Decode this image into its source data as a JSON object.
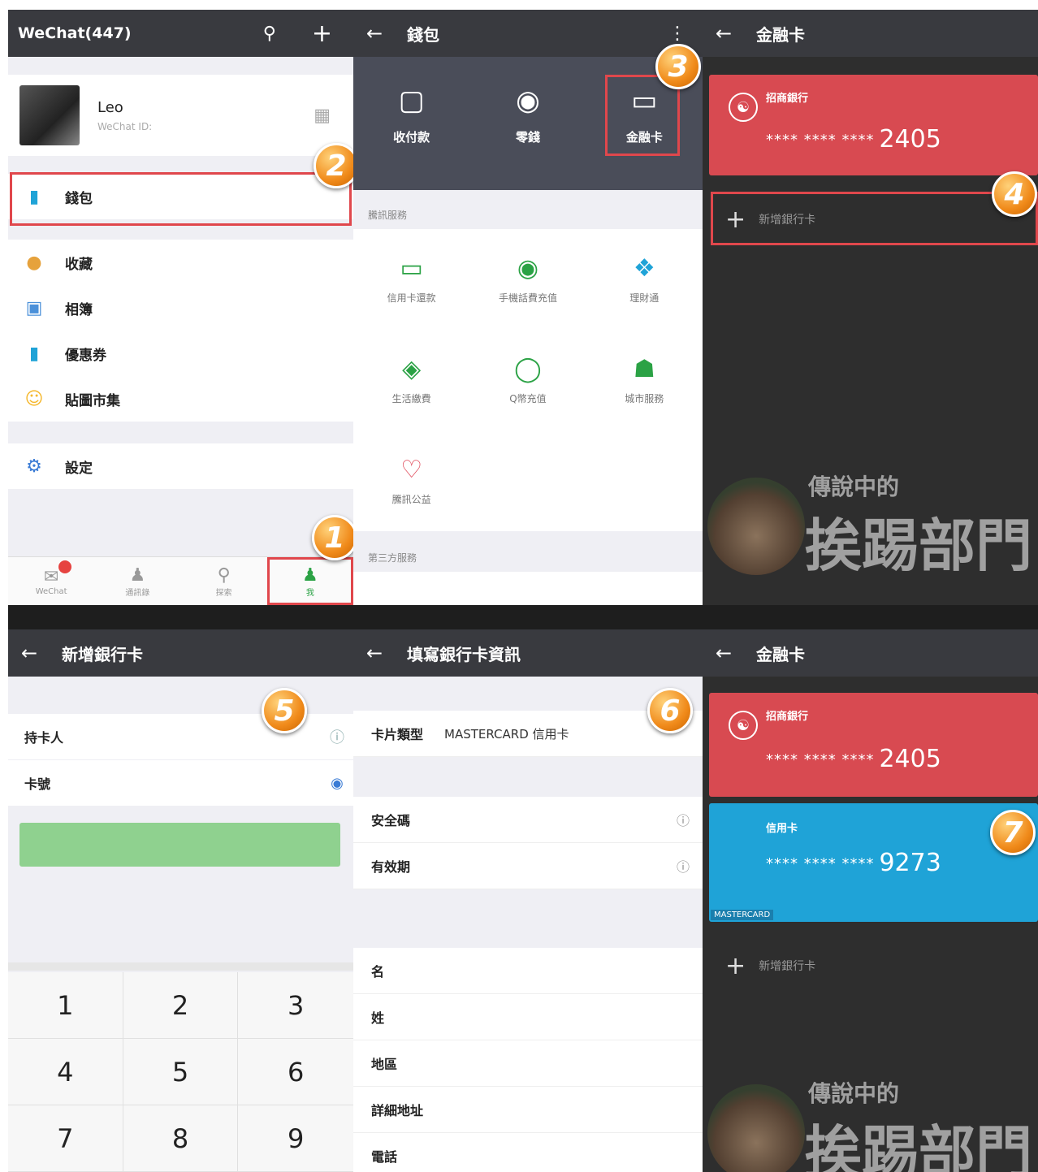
{
  "panel1": {
    "app_title": "WeChat(447)",
    "profile": {
      "name": "Leo",
      "wechat_id": "WeChat ID:"
    },
    "menu": [
      {
        "label": "錢包",
        "icon": "wallet-icon"
      },
      {
        "label": "收藏",
        "icon": "favorites-icon"
      },
      {
        "label": "相簿",
        "icon": "album-icon"
      },
      {
        "label": "優惠券",
        "icon": "coupon-icon"
      },
      {
        "label": "貼圖市集",
        "icon": "sticker-icon"
      },
      {
        "label": "設定",
        "icon": "settings-icon"
      }
    ],
    "tabs": [
      {
        "label": "WeChat",
        "icon": "chat-icon"
      },
      {
        "label": "通訊錄",
        "icon": "contacts-icon"
      },
      {
        "label": "探索",
        "icon": "discover-icon"
      },
      {
        "label": "我",
        "icon": "me-icon"
      }
    ]
  },
  "panel2": {
    "title": "錢包",
    "top_items": [
      {
        "label": "收付款",
        "sub": "",
        "icon": "scan-icon"
      },
      {
        "label": "零錢",
        "sub": "",
        "icon": "coin-icon"
      },
      {
        "label": "金融卡",
        "sub": "",
        "icon": "card-icon"
      }
    ],
    "section_title": "騰訊服務",
    "services": [
      {
        "label": "信用卡還款",
        "icon": "credit-card-icon"
      },
      {
        "label": "手機話費充值",
        "icon": "phone-topup-icon"
      },
      {
        "label": "理財通",
        "icon": "finance-icon"
      },
      {
        "label": "生活繳費",
        "icon": "bills-icon"
      },
      {
        "label": "Q幣充值",
        "icon": "qcoin-icon"
      },
      {
        "label": "城市服務",
        "icon": "city-icon"
      },
      {
        "label": "騰訊公益",
        "icon": "charity-icon"
      }
    ],
    "section_title_2": "第三方服務"
  },
  "panel3": {
    "title": "金融卡",
    "card": {
      "bank": "招商銀行",
      "type": "",
      "masked": "**** **** ****",
      "last4": "2405"
    },
    "add_label": "新增銀行卡"
  },
  "panel4": {
    "status_left": "",
    "status_right": "",
    "title": "新增銀行卡",
    "section_note": "",
    "holder_label": "持卡人",
    "holder_value": "",
    "cardno_label": "卡號",
    "cardno_placeholder": "",
    "keys": [
      "1",
      "2",
      "3",
      "4",
      "5",
      "6",
      "7",
      "8",
      "9"
    ]
  },
  "panel5": {
    "title": "填寫銀行卡資訊",
    "section1": "",
    "card_type_label": "卡片類型",
    "card_type_value": "MASTERCARD 信用卡",
    "section2": "",
    "cvv_label": "安全碼",
    "cvv_placeholder": "",
    "expiry_label": "有效期",
    "expiry_placeholder": "",
    "section3": "",
    "fields": [
      {
        "label": "名",
        "placeholder": ""
      },
      {
        "label": "姓",
        "placeholder": ""
      },
      {
        "label": "地區",
        "placeholder": ""
      },
      {
        "label": "詳細地址",
        "placeholder": ""
      },
      {
        "label": "電話",
        "placeholder": ""
      }
    ]
  },
  "panel6": {
    "title": "金融卡",
    "card1": {
      "bank": "招商銀行",
      "type": "",
      "masked": "**** **** ****",
      "last4": "2405"
    },
    "card2": {
      "bank": "信用卡",
      "masked": "**** **** ****",
      "last4": "9273",
      "brand": "MASTERCARD"
    },
    "add_label": "新增銀行卡"
  },
  "watermark": {
    "line1": "傳說中的",
    "line2": "挨踢部門"
  },
  "step_badges": [
    "1",
    "2",
    "3",
    "4",
    "5",
    "6",
    "7"
  ],
  "colors": {
    "topbar": "#393a3f",
    "red_card": "#d84a51",
    "blue_card": "#1fa3d7",
    "green": "#2ba245",
    "highlight": "#e0474c",
    "badge": "#f08a1a"
  }
}
